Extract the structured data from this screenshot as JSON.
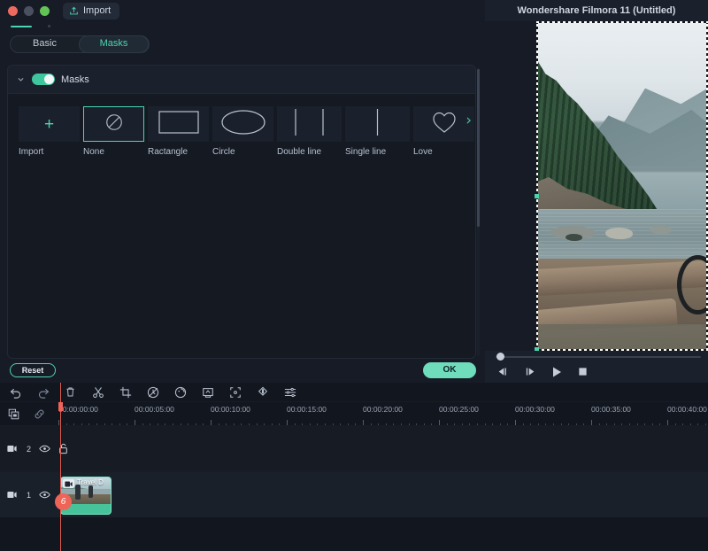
{
  "window": {
    "traffic_lights": [
      "close",
      "minimize",
      "zoom"
    ],
    "import_label": "Import",
    "preview_title": "Wondershare Filmora 11 (Untitled)"
  },
  "edit_panel": {
    "tabs": [
      {
        "label": "Basic",
        "active": false
      },
      {
        "label": "Masks",
        "active": true
      }
    ],
    "masks_section": {
      "title": "Masks",
      "enabled": true,
      "collapsed": false,
      "items": [
        {
          "label": "Import",
          "icon": "plus-icon",
          "selected": false
        },
        {
          "label": "None",
          "icon": "no-mask-icon",
          "selected": true
        },
        {
          "label": "Ractangle",
          "icon": "rectangle-icon",
          "selected": false
        },
        {
          "label": "Circle",
          "icon": "ellipse-icon",
          "selected": false
        },
        {
          "label": "Double line",
          "icon": "double-line-icon",
          "selected": false
        },
        {
          "label": "Single line",
          "icon": "single-line-icon",
          "selected": false
        },
        {
          "label": "Love",
          "icon": "heart-icon",
          "selected": false
        }
      ],
      "next_arrow": "›"
    },
    "reset_label": "Reset",
    "ok_label": "OK"
  },
  "preview": {
    "playback_buttons": [
      {
        "name": "previous-frame-button",
        "icon": "step-back-icon"
      },
      {
        "name": "next-frame-button",
        "icon": "step-forward-icon"
      },
      {
        "name": "play-button",
        "icon": "play-icon"
      },
      {
        "name": "stop-button",
        "icon": "stop-icon"
      }
    ]
  },
  "timeline": {
    "toolbar_icons": [
      "undo-icon",
      "redo-icon",
      "delete-icon",
      "split-scissors-icon",
      "crop-icon",
      "speed-icon",
      "color-icon",
      "green-screen-icon",
      "crop-zoom-icon",
      "mask-icon",
      "audio-mixer-icon"
    ],
    "subbar_icons": [
      "copy-icon",
      "link-icon"
    ],
    "ruler": {
      "labels": [
        "00:00:00:00",
        "00:00:05:00",
        "00:00:10:00",
        "00:00:15:00",
        "00:00:20:00",
        "00:00:25:00",
        "00:00:30:00",
        "00:00:35:00",
        "00:00:40:00"
      ]
    },
    "tracks": [
      {
        "number": "2",
        "visible": true,
        "locked": false,
        "clips": []
      },
      {
        "number": "1",
        "visible": true,
        "locked": false,
        "clips": [
          {
            "title": "Travel D",
            "badge": "video-icon"
          }
        ]
      }
    ],
    "marker_label": "6"
  },
  "colors": {
    "accent": "#4cd4b0",
    "accent_solid": "#6fdcbb",
    "playhead": "#e0594f",
    "panel_bg": "#161b26",
    "card_bg": "#141922",
    "timeline_bg": "#12161f"
  }
}
